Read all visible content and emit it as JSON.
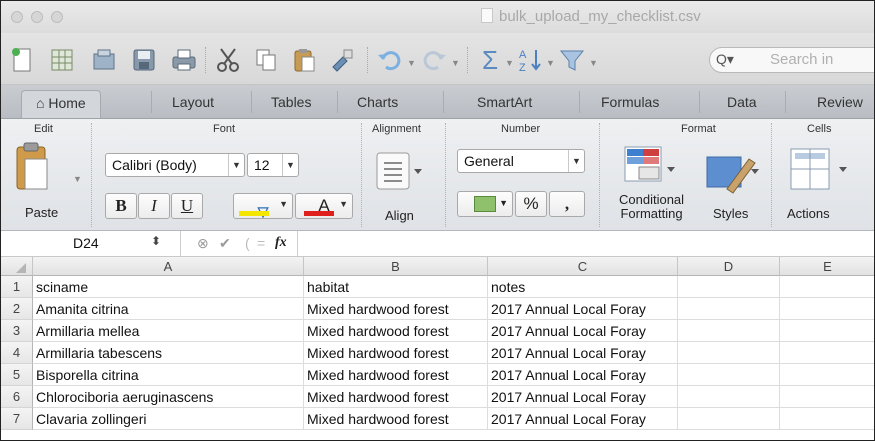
{
  "window": {
    "title": "bulk_upload_my_checklist.csv"
  },
  "toolbar": {
    "search_placeholder": "Search in"
  },
  "ribbon_tabs": [
    "Home",
    "Layout",
    "Tables",
    "Charts",
    "SmartArt",
    "Formulas",
    "Data",
    "Review"
  ],
  "ribbon": {
    "groups": {
      "edit": "Edit",
      "font": "Font",
      "alignment": "Alignment",
      "number": "Number",
      "format": "Format",
      "cells": "Cells"
    },
    "paste_label": "Paste",
    "font_name": "Calibri (Body)",
    "font_size": "12",
    "bold": "B",
    "italic": "I",
    "underline": "U",
    "font_color_letter": "A",
    "align_label": "Align",
    "number_format": "General",
    "percent": "%",
    "comma": ",",
    "conditional_formatting_line1": "Conditional",
    "conditional_formatting_line2": "Formatting",
    "styles_label": "Styles",
    "actions_label": "Actions",
    "colors": {
      "fill_yellow": "#f5e600",
      "font_red": "#e0201c"
    }
  },
  "formula_bar": {
    "cell_ref": "D24",
    "fx": "fx",
    "value": ""
  },
  "sheet": {
    "columns": [
      "A",
      "B",
      "C",
      "D",
      "E"
    ],
    "rows": [
      {
        "num": "1",
        "cells": [
          "sciname",
          "habitat",
          "notes",
          "",
          ""
        ]
      },
      {
        "num": "2",
        "cells": [
          "Amanita citrina",
          "Mixed hardwood forest",
          "2017 Annual Local Foray",
          "",
          ""
        ]
      },
      {
        "num": "3",
        "cells": [
          "Armillaria mellea",
          "Mixed hardwood forest",
          "2017 Annual Local Foray",
          "",
          ""
        ]
      },
      {
        "num": "4",
        "cells": [
          "Armillaria tabescens",
          "Mixed hardwood forest",
          "2017 Annual Local Foray",
          "",
          ""
        ]
      },
      {
        "num": "5",
        "cells": [
          "Bisporella citrina",
          "Mixed hardwood forest",
          "2017 Annual Local Foray",
          "",
          ""
        ]
      },
      {
        "num": "6",
        "cells": [
          "Chlorociboria aeruginascens",
          "Mixed hardwood forest",
          "2017 Annual Local Foray",
          "",
          ""
        ]
      },
      {
        "num": "7",
        "cells": [
          "Clavaria zollingeri",
          "Mixed hardwood forest",
          "2017 Annual Local Foray",
          "",
          ""
        ]
      }
    ]
  }
}
